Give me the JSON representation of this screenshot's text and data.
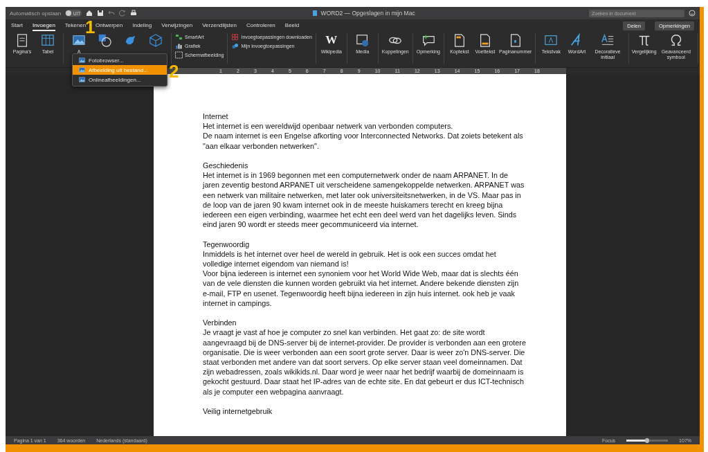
{
  "title_bar": {
    "autosave_label": "Automatisch opslaan",
    "autosave_on": false,
    "autosave_state": "UIT",
    "document_title": "WORD2 — Opgeslagen in mijn Mac",
    "search": {
      "placeholder": "Zoeken in document"
    }
  },
  "tabs": [
    {
      "label": "Start",
      "selected": false
    },
    {
      "label": "Invoegen",
      "selected": true
    },
    {
      "label": "Tekenen",
      "selected": false
    },
    {
      "label": "Ontwerpen",
      "selected": false
    },
    {
      "label": "Indeling",
      "selected": false
    },
    {
      "label": "Verwijzingen",
      "selected": false
    },
    {
      "label": "Verzendlijsten",
      "selected": false
    },
    {
      "label": "Controleren",
      "selected": false
    },
    {
      "label": "Beeld",
      "selected": false
    }
  ],
  "share_buttons": [
    "Delen",
    "Opmerkingen"
  ],
  "ribbon": {
    "groups": [
      {
        "kind": "large",
        "items": [
          {
            "label": "Pagina's"
          },
          {
            "label": "Tabel"
          }
        ]
      },
      {
        "kind": "large",
        "items": [
          {
            "label": "A"
          }
        ]
      },
      {
        "kind": "small",
        "items": [
          {
            "label": "SmartArt"
          },
          {
            "label": "Grafiek"
          },
          {
            "label": "Schermafbeelding"
          }
        ]
      },
      {
        "kind": "small",
        "items": [
          {
            "label": "Invoegtoepassingen downloaden"
          },
          {
            "label": "Mijn invoegtoepassingen"
          }
        ]
      },
      {
        "kind": "large",
        "items": [
          {
            "label": "Wikipedia",
            "symbol": "W"
          }
        ]
      },
      {
        "kind": "large",
        "items": [
          {
            "label": "Media"
          }
        ]
      },
      {
        "kind": "large",
        "items": [
          {
            "label": "Koppelingen"
          }
        ]
      },
      {
        "kind": "large",
        "items": [
          {
            "label": "Opmerking"
          }
        ]
      },
      {
        "kind": "large",
        "items": [
          {
            "label": "Koptekst"
          },
          {
            "label": "Voettekst"
          },
          {
            "label": "Paginanummer"
          }
        ]
      },
      {
        "kind": "large",
        "items": [
          {
            "label": "Tekstvak"
          },
          {
            "label": "WordArt"
          },
          {
            "label": "Decoratieve initiaal"
          }
        ]
      },
      {
        "kind": "large",
        "items": [
          {
            "label": "Vergelijking"
          },
          {
            "label": "Geavanceerd symbool"
          }
        ]
      }
    ]
  },
  "picture_menu": [
    {
      "label": "Fotobrowser...",
      "selected": false
    },
    {
      "label": "Afbeelding uit bestand...",
      "selected": true
    },
    {
      "label": "Onlineafbeeldingen...",
      "selected": false
    }
  ],
  "callouts": [
    "1",
    "2"
  ],
  "ruler": [
    "1",
    "2",
    "3",
    "4",
    "5",
    "6",
    "7",
    "8",
    "9",
    "10",
    "11",
    "12",
    "13",
    "14",
    "15",
    "16",
    "17",
    "18"
  ],
  "document": [
    {
      "heading": "Internet",
      "paragraphs": [
        "Het internet is een wereldwijd openbaar netwerk van verbonden computers.",
        "De naam internet is een Engelse afkorting voor Interconnected Networks. Dat zoiets betekent als \"aan elkaar verbonden netwerken\"."
      ]
    },
    {
      "heading": "Geschiedenis",
      "paragraphs": [
        "Het internet is in 1969 begonnen met een computernetwerk onder de naam ARPANET. In de jaren zeventig bestond ARPANET uit verscheidene samengekoppelde netwerken. ARPANET was een netwerk van militaire netwerken, met later ook universiteitsnetwerken, in de VS. Maar pas in de loop van de jaren 90 kwam internet ook in de meeste huiskamers terecht en kreeg bijna iedereen een eigen verbinding, waarmee het echt een deel werd van het dagelijks leven. Sinds eind jaren 90 wordt er steeds meer gecommuniceerd via internet."
      ]
    },
    {
      "heading": "Tegenwoordig",
      "paragraphs": [
        "Inmiddels is het internet over heel de wereld in gebruik. Het is ook een succes omdat het volledige internet eigendom van niemand is!",
        "Voor bijna iedereen is internet een synoniem voor het World Wide Web, maar dat is slechts één van de vele diensten die kunnen worden gebruikt via het internet. Andere bekende diensten zijn e-mail, FTP en usenet. Tegenwoordig heeft bijna iedereen in zijn huis internet. ook heb je vaak internet in campings."
      ]
    },
    {
      "heading": "Verbinden",
      "paragraphs": [
        "Je vraagt je vast af hoe je computer zo snel kan verbinden. Het gaat zo: de site wordt aangevraagd bij de DNS-server bij de internet-provider. De provider is verbonden aan een grotere organisatie. Die is weer verbonden aan een soort grote server. Daar is weer zo'n DNS-server. Die staat verbonden met andere van dat soort servers. Op elke server staan veel domeinnamen. Dat zijn webadressen, zoals wikikids.nl. Daar word je weer naar het bedrijf waarbij de domeinnaam is gekocht gestuurd. Daar staat het IP-adres van de echte site. En dat gebeurt er dus ICT-technisch als je computer een webpagina aanvraagt."
      ]
    },
    {
      "heading": "Veilig internetgebruik"
    }
  ],
  "status_bar": {
    "page": "Pagina 1 van 1",
    "words": "364 woorden",
    "language": "Nederlands (standaard)",
    "focus": "Focus",
    "zoom": {
      "level": 0.5,
      "reading": "107%"
    }
  }
}
